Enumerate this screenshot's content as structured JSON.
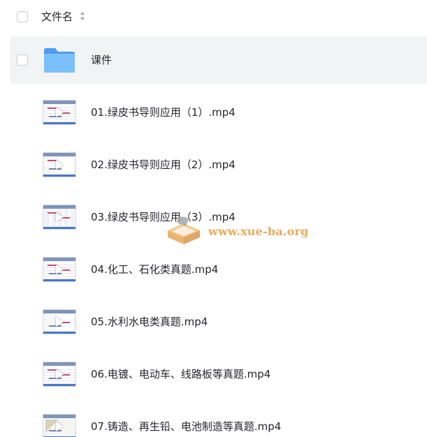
{
  "header": {
    "column_title": "文件名",
    "sort_icon": "sort-icon"
  },
  "rows": [
    {
      "name": "课件",
      "icon": "folder-icon",
      "selected": true
    },
    {
      "name": "01.绿皮书导则应用（1）.mp4",
      "icon": "video-thumbnail"
    },
    {
      "name": "02.绿皮书导则应用（2）.mp4",
      "icon": "video-thumbnail"
    },
    {
      "name": "03.绿皮书导则应用（3）.mp4",
      "icon": "video-thumbnail"
    },
    {
      "name": "04.化工、石化类真题.mp4",
      "icon": "video-thumbnail"
    },
    {
      "name": "05.水利水电类真题.mp4",
      "icon": "video-thumbnail"
    },
    {
      "name": "06.电镀、电动车、线路板等真题.mp4",
      "icon": "video-thumbnail"
    },
    {
      "name": "07.铸造、再生铅、电池制造等真题.mp4",
      "icon": "video-thumbnail"
    }
  ],
  "watermark": {
    "text": "www.xue-ba.org"
  },
  "colors": {
    "selected_row": "#f2f3f5",
    "folder": "#5aa8f0",
    "watermark": "#e9a14a"
  }
}
